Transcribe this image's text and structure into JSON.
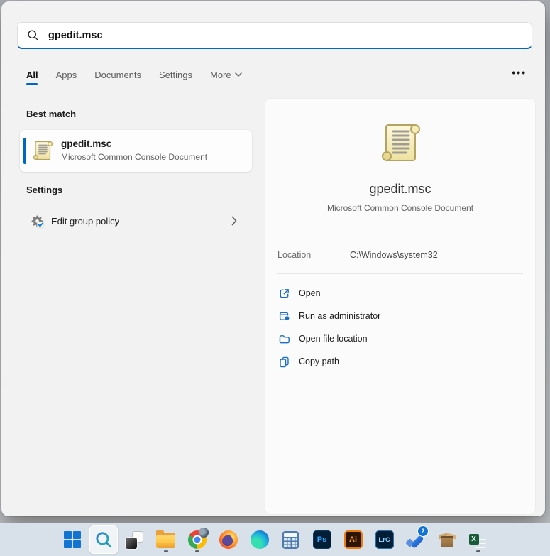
{
  "colors": {
    "accent": "#0067c0",
    "action_icon_blue": "#1b6ec2",
    "taskbar_bg": "#d8e1e9"
  },
  "search_box": {
    "value": "gpedit.msc"
  },
  "tabs": {
    "items": [
      {
        "label": "All",
        "active": true
      },
      {
        "label": "Apps",
        "active": false
      },
      {
        "label": "Documents",
        "active": false
      },
      {
        "label": "Settings",
        "active": false
      },
      {
        "label": "More",
        "active": false
      }
    ],
    "overflow_glyph": "•••"
  },
  "left_pane": {
    "best_match_header": "Best match",
    "best_match": {
      "title": "gpedit.msc",
      "subtitle": "Microsoft Common Console Document"
    },
    "settings_header": "Settings",
    "settings_item": {
      "label": "Edit group policy"
    }
  },
  "detail_pane": {
    "title": "gpedit.msc",
    "subtitle": "Microsoft Common Console Document",
    "location_label": "Location",
    "location_value": "C:\\Windows\\system32",
    "actions": [
      {
        "icon": "open-icon",
        "label": "Open"
      },
      {
        "icon": "run-as-admin-icon",
        "label": "Run as administrator"
      },
      {
        "icon": "folder-icon",
        "label": "Open file location"
      },
      {
        "icon": "copy-icon",
        "label": "Copy path"
      }
    ]
  },
  "taskbar": {
    "icons": [
      "start-icon",
      "search-icon",
      "task-view-icon",
      "file-explorer-icon",
      "chrome-icon",
      "firefox-icon",
      "edge-icon",
      "calculator-icon",
      "photoshop-icon",
      "illustrator-icon",
      "lightroom-icon",
      "todo-check-icon",
      "box-app-icon",
      "excel-icon"
    ],
    "running_apps": [
      "file-explorer",
      "chrome",
      "excel"
    ],
    "photoshop_label": "Ps",
    "illustrator_label": "Ai",
    "lightroom_label": "LrC",
    "todo_badge_count": "2",
    "excel_label": "X"
  }
}
